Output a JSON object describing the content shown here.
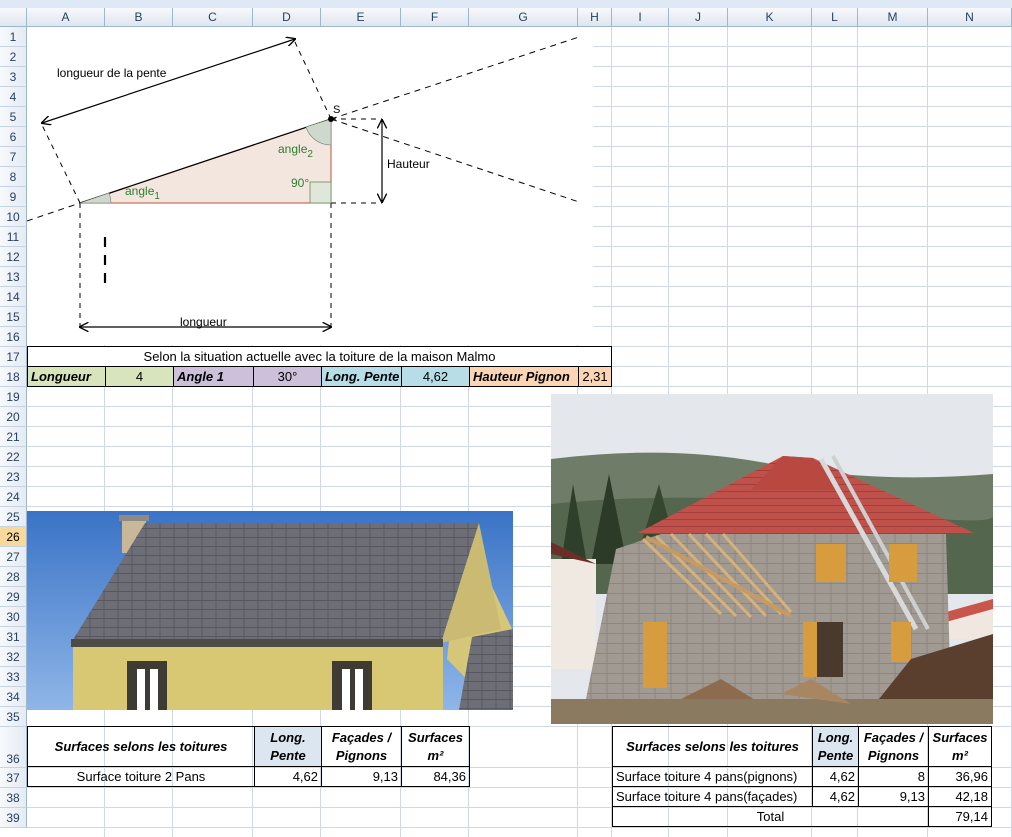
{
  "columns": [
    "A",
    "B",
    "C",
    "D",
    "E",
    "F",
    "G",
    "H",
    "I",
    "J",
    "K",
    "L",
    "M",
    "N"
  ],
  "rows": [
    "1",
    "2",
    "3",
    "4",
    "5",
    "6",
    "7",
    "8",
    "9",
    "10",
    "11",
    "12",
    "13",
    "14",
    "15",
    "16",
    "17",
    "18",
    "19",
    "20",
    "21",
    "22",
    "23",
    "24",
    "25",
    "26",
    "27",
    "28",
    "29",
    "30",
    "31",
    "32",
    "33",
    "34",
    "35",
    "36",
    "37",
    "38",
    "39"
  ],
  "selected_row": "26",
  "diagram": {
    "slope_label": "longueur de la pente",
    "apex_label": "S",
    "angle2": "angle",
    "angle2_sub": "2",
    "right_angle": "90°",
    "angle1": "angle",
    "angle1_sub": "1",
    "height_label": "Hauteur",
    "length_label": "longueur"
  },
  "summary": {
    "title": "Selon la situation actuelle avec la toiture de la maison Malmo",
    "longueur_label": "Longueur",
    "longueur_value": "4",
    "angle_label": "Angle 1",
    "angle_value": "30°",
    "pente_label": "Long. Pente",
    "pente_value": "4,62",
    "pignon_label": "Hauteur Pignon",
    "pignon_value": "2,31",
    "colors": {
      "longueur": "#d8e4bc",
      "angle": "#ccc0da",
      "pente": "#b7dee8",
      "pignon": "#fcd5b4"
    }
  },
  "table_left": {
    "headers": [
      "Surfaces selons les toitures",
      "Long. Pente",
      "Façades / Pignons",
      "Surfaces m²"
    ],
    "rows": [
      [
        "Surface toiture 2 Pans",
        "4,62",
        "9,13",
        "84,36"
      ]
    ]
  },
  "table_right": {
    "headers": [
      "Surfaces selons les toitures",
      "Long. Pente",
      "Façades / Pignons",
      "Surfaces m²"
    ],
    "rows": [
      [
        "Surface toiture 4 pans(pignons)",
        "4,62",
        "8",
        "36,96"
      ],
      [
        "Surface toiture 4 pans(façades)",
        "4,62",
        "9,13",
        "42,18"
      ]
    ],
    "total_label": "Total",
    "total_value": "79,14",
    "header_color": "#dce6f1"
  }
}
